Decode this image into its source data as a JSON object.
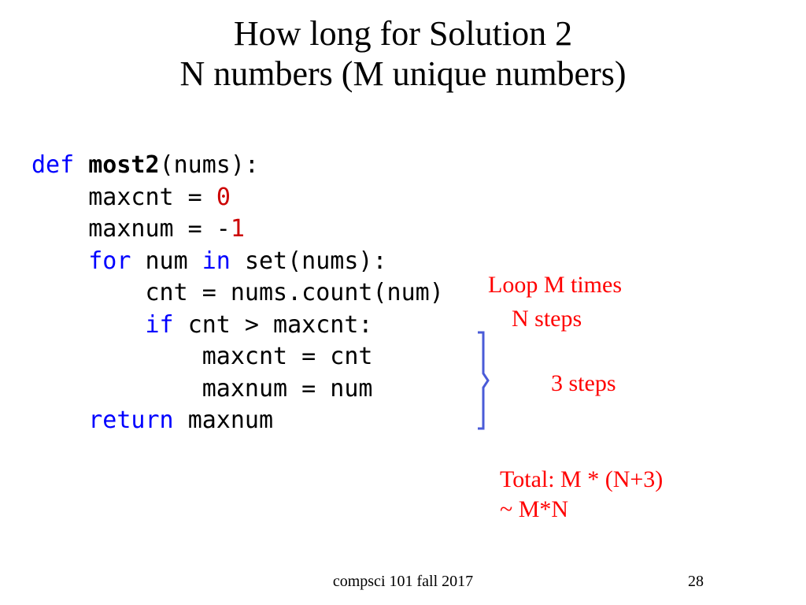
{
  "title": {
    "line1": "How long for Solution 2",
    "line2": "N numbers (M unique numbers)"
  },
  "code": {
    "def": "def ",
    "fn": "most2",
    "params": "(nums):",
    "l2a": "    maxcnt = ",
    "l2n": "0",
    "l3a": "    maxnum = -",
    "l3n": "1",
    "l4a": "    ",
    "for": "for ",
    "l4b": "num ",
    "in": "in ",
    "l4c": "set(nums):",
    "l5": "        cnt = nums.count(num)",
    "l6a": "        ",
    "if": "if ",
    "l6b": "cnt > maxcnt:",
    "l7": "            maxcnt = cnt",
    "l8": "            maxnum = num",
    "l9a": "    ",
    "return": "return ",
    "l9b": "maxnum"
  },
  "annotations": {
    "loop": "Loop M times",
    "nsteps": "N steps",
    "steps3": "3 steps",
    "total_l1": "Total: M * (N+3)",
    "total_l2": "~  M*N"
  },
  "footer": {
    "course": "compsci 101 fall 2017",
    "page": "28"
  }
}
